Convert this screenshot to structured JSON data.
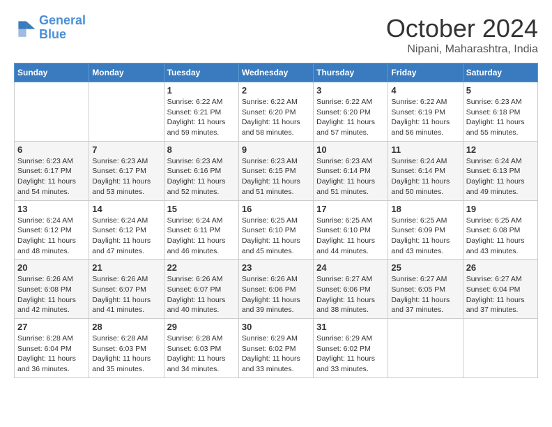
{
  "header": {
    "logo_line1": "General",
    "logo_line2": "Blue",
    "month": "October 2024",
    "location": "Nipani, Maharashtra, India"
  },
  "weekdays": [
    "Sunday",
    "Monday",
    "Tuesday",
    "Wednesday",
    "Thursday",
    "Friday",
    "Saturday"
  ],
  "weeks": [
    [
      {
        "day": "",
        "sunrise": "",
        "sunset": "",
        "daylight": ""
      },
      {
        "day": "",
        "sunrise": "",
        "sunset": "",
        "daylight": ""
      },
      {
        "day": "1",
        "sunrise": "Sunrise: 6:22 AM",
        "sunset": "Sunset: 6:21 PM",
        "daylight": "Daylight: 11 hours and 59 minutes."
      },
      {
        "day": "2",
        "sunrise": "Sunrise: 6:22 AM",
        "sunset": "Sunset: 6:20 PM",
        "daylight": "Daylight: 11 hours and 58 minutes."
      },
      {
        "day": "3",
        "sunrise": "Sunrise: 6:22 AM",
        "sunset": "Sunset: 6:20 PM",
        "daylight": "Daylight: 11 hours and 57 minutes."
      },
      {
        "day": "4",
        "sunrise": "Sunrise: 6:22 AM",
        "sunset": "Sunset: 6:19 PM",
        "daylight": "Daylight: 11 hours and 56 minutes."
      },
      {
        "day": "5",
        "sunrise": "Sunrise: 6:23 AM",
        "sunset": "Sunset: 6:18 PM",
        "daylight": "Daylight: 11 hours and 55 minutes."
      }
    ],
    [
      {
        "day": "6",
        "sunrise": "Sunrise: 6:23 AM",
        "sunset": "Sunset: 6:17 PM",
        "daylight": "Daylight: 11 hours and 54 minutes."
      },
      {
        "day": "7",
        "sunrise": "Sunrise: 6:23 AM",
        "sunset": "Sunset: 6:17 PM",
        "daylight": "Daylight: 11 hours and 53 minutes."
      },
      {
        "day": "8",
        "sunrise": "Sunrise: 6:23 AM",
        "sunset": "Sunset: 6:16 PM",
        "daylight": "Daylight: 11 hours and 52 minutes."
      },
      {
        "day": "9",
        "sunrise": "Sunrise: 6:23 AM",
        "sunset": "Sunset: 6:15 PM",
        "daylight": "Daylight: 11 hours and 51 minutes."
      },
      {
        "day": "10",
        "sunrise": "Sunrise: 6:23 AM",
        "sunset": "Sunset: 6:14 PM",
        "daylight": "Daylight: 11 hours and 51 minutes."
      },
      {
        "day": "11",
        "sunrise": "Sunrise: 6:24 AM",
        "sunset": "Sunset: 6:14 PM",
        "daylight": "Daylight: 11 hours and 50 minutes."
      },
      {
        "day": "12",
        "sunrise": "Sunrise: 6:24 AM",
        "sunset": "Sunset: 6:13 PM",
        "daylight": "Daylight: 11 hours and 49 minutes."
      }
    ],
    [
      {
        "day": "13",
        "sunrise": "Sunrise: 6:24 AM",
        "sunset": "Sunset: 6:12 PM",
        "daylight": "Daylight: 11 hours and 48 minutes."
      },
      {
        "day": "14",
        "sunrise": "Sunrise: 6:24 AM",
        "sunset": "Sunset: 6:12 PM",
        "daylight": "Daylight: 11 hours and 47 minutes."
      },
      {
        "day": "15",
        "sunrise": "Sunrise: 6:24 AM",
        "sunset": "Sunset: 6:11 PM",
        "daylight": "Daylight: 11 hours and 46 minutes."
      },
      {
        "day": "16",
        "sunrise": "Sunrise: 6:25 AM",
        "sunset": "Sunset: 6:10 PM",
        "daylight": "Daylight: 11 hours and 45 minutes."
      },
      {
        "day": "17",
        "sunrise": "Sunrise: 6:25 AM",
        "sunset": "Sunset: 6:10 PM",
        "daylight": "Daylight: 11 hours and 44 minutes."
      },
      {
        "day": "18",
        "sunrise": "Sunrise: 6:25 AM",
        "sunset": "Sunset: 6:09 PM",
        "daylight": "Daylight: 11 hours and 43 minutes."
      },
      {
        "day": "19",
        "sunrise": "Sunrise: 6:25 AM",
        "sunset": "Sunset: 6:08 PM",
        "daylight": "Daylight: 11 hours and 43 minutes."
      }
    ],
    [
      {
        "day": "20",
        "sunrise": "Sunrise: 6:26 AM",
        "sunset": "Sunset: 6:08 PM",
        "daylight": "Daylight: 11 hours and 42 minutes."
      },
      {
        "day": "21",
        "sunrise": "Sunrise: 6:26 AM",
        "sunset": "Sunset: 6:07 PM",
        "daylight": "Daylight: 11 hours and 41 minutes."
      },
      {
        "day": "22",
        "sunrise": "Sunrise: 6:26 AM",
        "sunset": "Sunset: 6:07 PM",
        "daylight": "Daylight: 11 hours and 40 minutes."
      },
      {
        "day": "23",
        "sunrise": "Sunrise: 6:26 AM",
        "sunset": "Sunset: 6:06 PM",
        "daylight": "Daylight: 11 hours and 39 minutes."
      },
      {
        "day": "24",
        "sunrise": "Sunrise: 6:27 AM",
        "sunset": "Sunset: 6:06 PM",
        "daylight": "Daylight: 11 hours and 38 minutes."
      },
      {
        "day": "25",
        "sunrise": "Sunrise: 6:27 AM",
        "sunset": "Sunset: 6:05 PM",
        "daylight": "Daylight: 11 hours and 37 minutes."
      },
      {
        "day": "26",
        "sunrise": "Sunrise: 6:27 AM",
        "sunset": "Sunset: 6:04 PM",
        "daylight": "Daylight: 11 hours and 37 minutes."
      }
    ],
    [
      {
        "day": "27",
        "sunrise": "Sunrise: 6:28 AM",
        "sunset": "Sunset: 6:04 PM",
        "daylight": "Daylight: 11 hours and 36 minutes."
      },
      {
        "day": "28",
        "sunrise": "Sunrise: 6:28 AM",
        "sunset": "Sunset: 6:03 PM",
        "daylight": "Daylight: 11 hours and 35 minutes."
      },
      {
        "day": "29",
        "sunrise": "Sunrise: 6:28 AM",
        "sunset": "Sunset: 6:03 PM",
        "daylight": "Daylight: 11 hours and 34 minutes."
      },
      {
        "day": "30",
        "sunrise": "Sunrise: 6:29 AM",
        "sunset": "Sunset: 6:02 PM",
        "daylight": "Daylight: 11 hours and 33 minutes."
      },
      {
        "day": "31",
        "sunrise": "Sunrise: 6:29 AM",
        "sunset": "Sunset: 6:02 PM",
        "daylight": "Daylight: 11 hours and 33 minutes."
      },
      {
        "day": "",
        "sunrise": "",
        "sunset": "",
        "daylight": ""
      },
      {
        "day": "",
        "sunrise": "",
        "sunset": "",
        "daylight": ""
      }
    ]
  ]
}
